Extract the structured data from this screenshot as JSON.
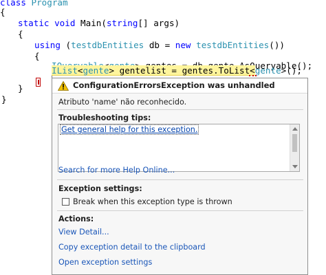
{
  "code": {
    "line1": {
      "kw": "class",
      "name": "Program"
    },
    "line2": "{",
    "line3": {
      "kw1": "static",
      "kw2": "void",
      "rest": "Main(",
      "kw3": "string",
      "rest2": "[] args)"
    },
    "line4": "{",
    "line5": {
      "kw": "using",
      "p1": "(",
      "t1": "testdbEntities",
      "mid": " db = ",
      "kw2": "new",
      "t2": "testdbEntities",
      "end": "())"
    },
    "line6": "{",
    "line7": {
      "t1": "IQueryable",
      "lt": "<",
      "t2": "gente",
      "gt": ">",
      "rest": " gentes = db.gente.AsQueryable();"
    },
    "line8": {
      "t1": "IList",
      "lt": "<",
      "t2": "gente",
      "gt": ">",
      "rest": " gentelist = gentes.ToList<",
      "t3": "gente",
      "end": ">();"
    },
    "line9": "}",
    "line10": "}",
    "line11": "}"
  },
  "exception": {
    "title": "ConfigurationErrorsException was unhandled",
    "message": "Atributo 'name' não reconhecido.",
    "troubleshooting_title": "Troubleshooting tips:",
    "tip_link": "Get general help for this exception.",
    "search_link": "Search for more Help Online...",
    "settings_title": "Exception settings:",
    "break_label": "Break when this exception type is thrown",
    "break_checked": false,
    "actions_title": "Actions:",
    "view_detail": "View Detail...",
    "copy_detail": "Copy exception detail to the clipboard",
    "open_settings": "Open exception settings"
  },
  "colors": {
    "keyword": "#0000ff",
    "type": "#2b91af",
    "current_line": "#fff59d",
    "link": "#1a56b8",
    "warning": "#f2c200"
  },
  "icons": [
    "warning-icon",
    "error-margin-icon"
  ]
}
